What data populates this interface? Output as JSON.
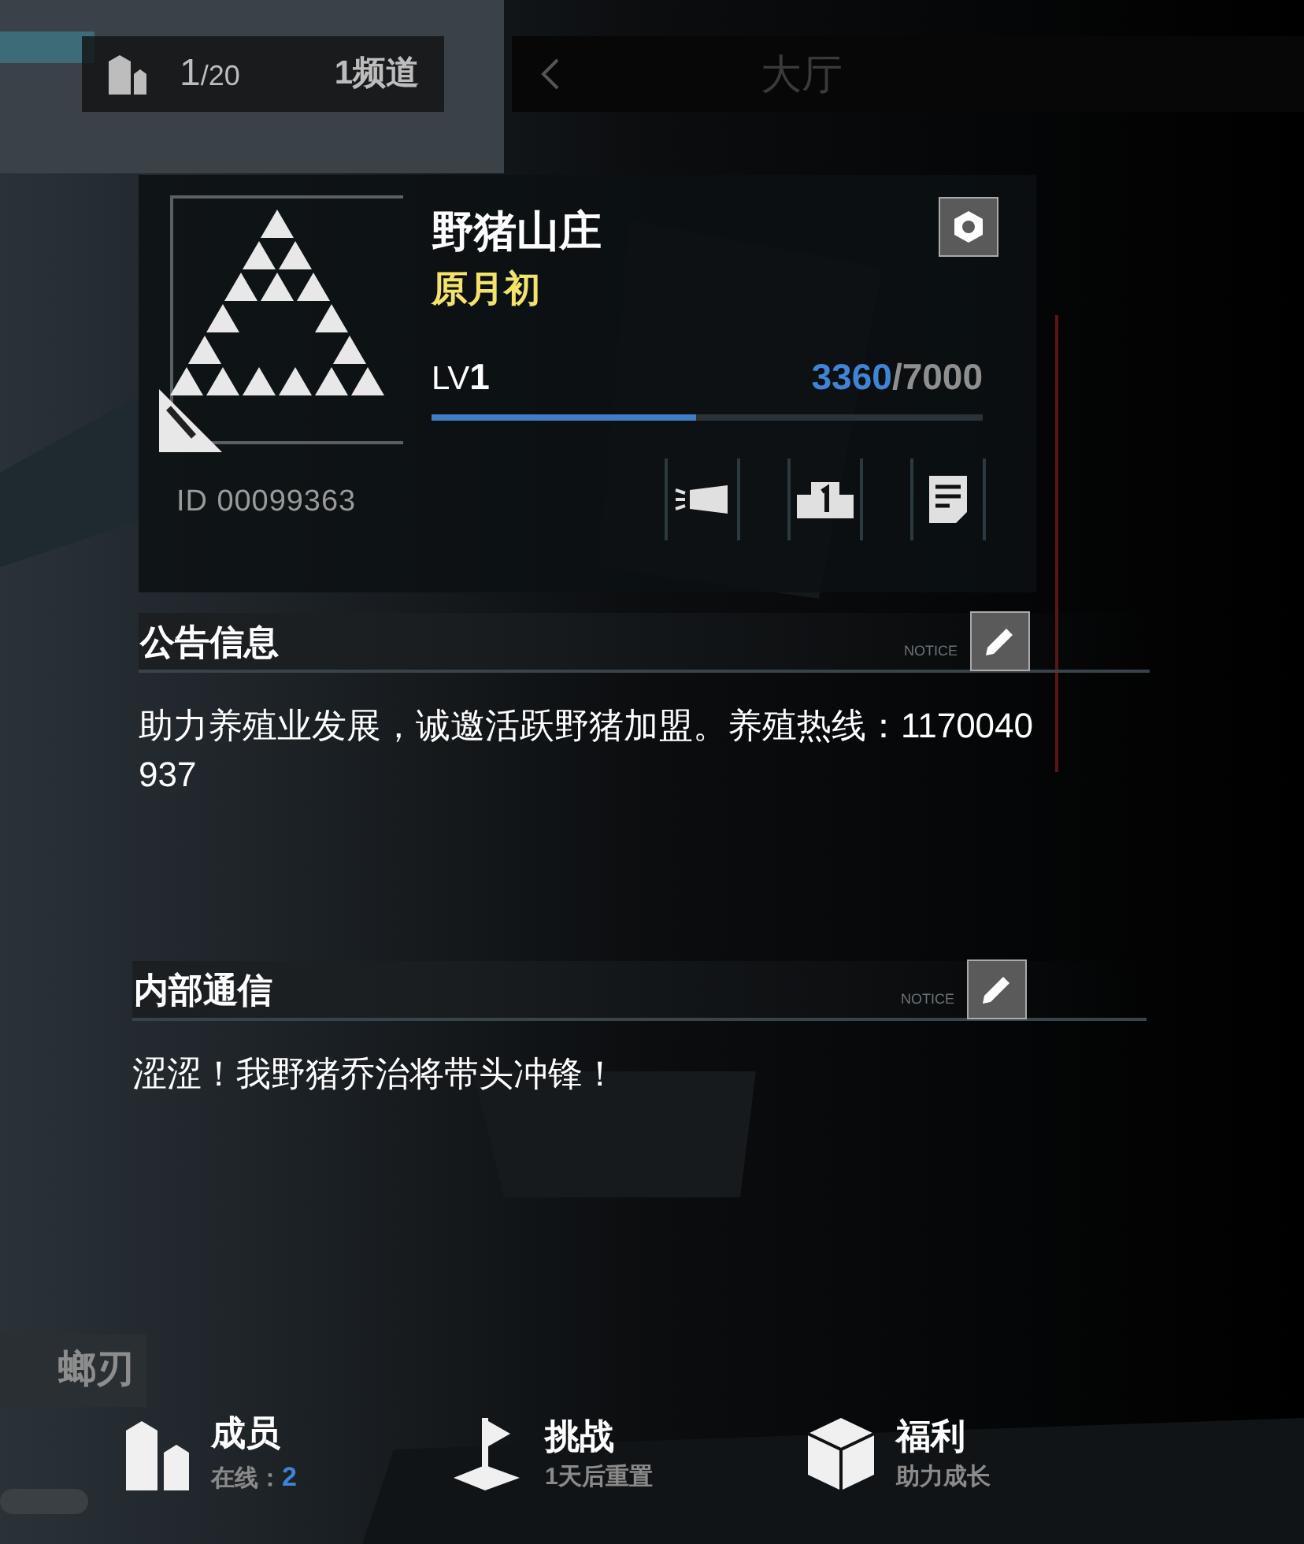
{
  "top_bar": {
    "member_count": "1",
    "member_capacity": "/20",
    "channel": "1频道",
    "title": "大厅"
  },
  "guild": {
    "name": "野猪山庄",
    "leader": "原月初",
    "lv_label": "LV",
    "lv": "1",
    "exp": "3360",
    "exp_max": "/7000",
    "progress": {
      "level": 0.48
    },
    "id_label": "ID",
    "id": "00099363"
  },
  "sections": [
    {
      "title": "公告信息",
      "tag": "NOTICE",
      "text": "助力养殖业发展，诚邀活跃野猪加盟。养殖热线：1170040937"
    },
    {
      "title": "内部通信",
      "tag": "NOTICE",
      "text": "涩涩！我野猪乔治将带头冲锋！"
    }
  ],
  "side_tab": "螂刃",
  "bottom_nav": [
    {
      "kind": "members",
      "label": "成员",
      "sub_label": "在线：",
      "sub_value": "2"
    },
    {
      "kind": "challenge",
      "label": "挑战",
      "sub_label": "1天后重置"
    },
    {
      "kind": "welfare",
      "label": "福利",
      "sub_label": "助力成长"
    }
  ]
}
